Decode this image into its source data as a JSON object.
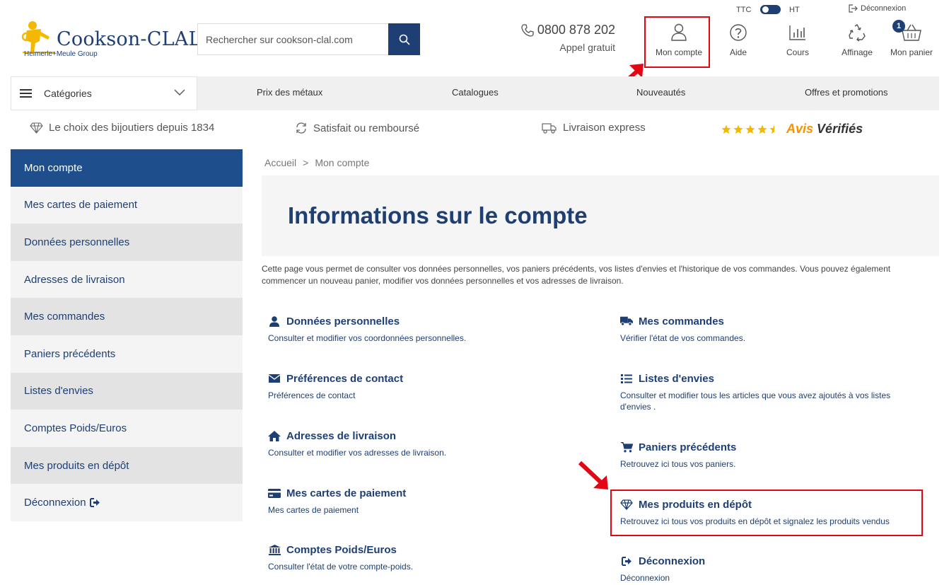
{
  "header": {
    "logo_name": "Cookson-CLAL",
    "logo_sub": "Heimerle+Meule Group",
    "search_placeholder": "Rechercher sur cookson-clal.com",
    "phone_number": "0800 878 202",
    "phone_sub": "Appel gratuit",
    "ttc_label": "TTC",
    "ht_label": "HT",
    "logout_label": "Déconnexion",
    "nav": {
      "account": "Mon compte",
      "help": "Aide",
      "rates": "Cours",
      "refining": "Affinage",
      "cart": "Mon panier"
    },
    "cart_count": "1"
  },
  "navbar": {
    "categories": "Catégories",
    "links": [
      "Prix des métaux",
      "Catalogues",
      "Nouveautés",
      "Offres et promotions"
    ]
  },
  "benefits": {
    "b1": "Le choix des bijoutiers depuis 1834",
    "b2": "Satisfait ou remboursé",
    "b3": "Livraison express",
    "rating_stars": 4.5,
    "avis_1": "Avis",
    "avis_2": "Vérifiés"
  },
  "sidebar": {
    "items": [
      "Mon compte",
      "Mes cartes de paiement",
      "Données personnelles",
      "Adresses de livraison",
      "Mes commandes",
      "Paniers précédents",
      "Listes d'envies",
      "Comptes Poids/Euros",
      "Mes produits en dépôt",
      "Déconnexion"
    ]
  },
  "breadcrumb": {
    "home": "Accueil",
    "sep": ">",
    "current": "Mon compte"
  },
  "main": {
    "title": "Informations sur le compte",
    "intro": "Cette page vous permet de consulter vos données personnelles, vos paniers précédents, vos listes d'envies et l'historique de vos commandes. Vous pouvez également commencer un nouveau panier, modifier vos données personnelles et vos adresses de livraison.",
    "cards": {
      "personal": {
        "title": "Données personnelles",
        "desc": "Consulter et modifier vos coordonnées personnelles."
      },
      "contact": {
        "title": "Préférences de contact",
        "desc": "Préférences de contact"
      },
      "addresses": {
        "title": "Adresses de livraison",
        "desc": "Consulter et modifier vos adresses de livraison."
      },
      "cards_pay": {
        "title": "Mes cartes de paiement",
        "desc": "Mes cartes de paiement"
      },
      "weight": {
        "title": "Comptes Poids/Euros",
        "desc": "Consulter l'état de votre compte-poids."
      },
      "orders": {
        "title": "Mes commandes",
        "desc": "Vérifier l'état de vos commandes."
      },
      "wishlists": {
        "title": "Listes d'envies",
        "desc": "Consulter et modifier tous les articles que vous avez ajoutés à vos listes d'envies ."
      },
      "baskets": {
        "title": "Paniers précédents",
        "desc": "Retrouvez ici tous vos paniers."
      },
      "deposit": {
        "title": "Mes produits en dépôt",
        "desc": "Retrouvez ici tous vos produits en dépôt et signalez les produits vendus"
      },
      "logout": {
        "title": "Déconnexion",
        "desc": "Déconnexion"
      }
    }
  },
  "colors": {
    "brand": "#1e3f73",
    "active_sidebar": "#1e4f8c",
    "annotation": "#e30613",
    "stars": "#f5b800"
  }
}
